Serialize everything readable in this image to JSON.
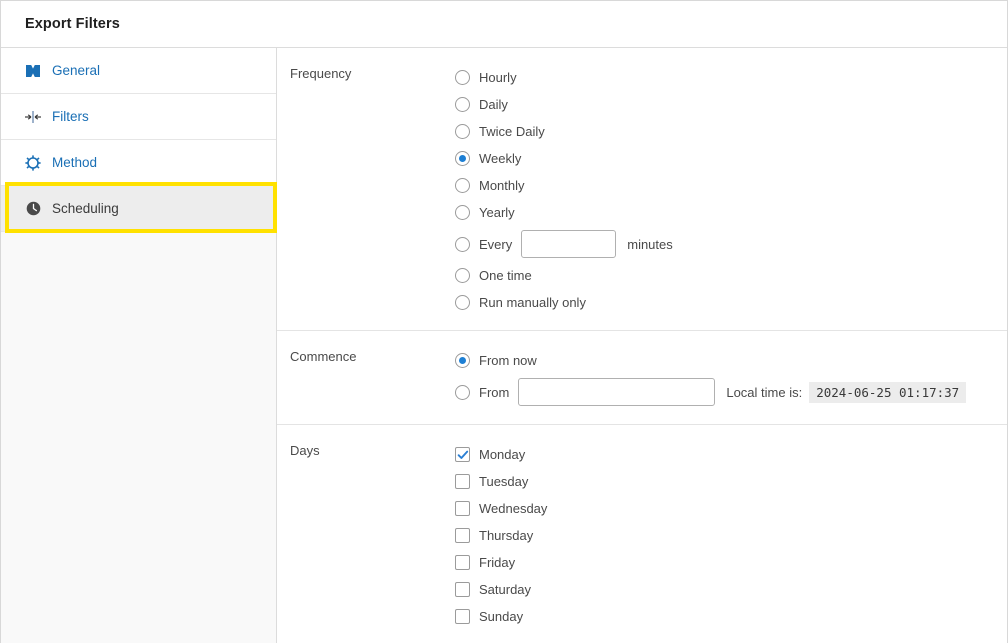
{
  "header": {
    "title": "Export Filters"
  },
  "sidebar": {
    "items": [
      {
        "label": "General",
        "icon": "ticket-icon",
        "selected": false
      },
      {
        "label": "Filters",
        "icon": "filter-arrows-icon",
        "selected": false
      },
      {
        "label": "Method",
        "icon": "gear-icon",
        "selected": false
      },
      {
        "label": "Scheduling",
        "icon": "clock-icon",
        "selected": true
      }
    ],
    "highlight_color": "#ffe100"
  },
  "main": {
    "sections": [
      {
        "label": "Frequency",
        "options": [
          {
            "label": "Hourly",
            "checked": false
          },
          {
            "label": "Daily",
            "checked": false
          },
          {
            "label": "Twice Daily",
            "checked": false
          },
          {
            "label": "Weekly",
            "checked": true
          },
          {
            "label": "Monthly",
            "checked": false
          },
          {
            "label": "Yearly",
            "checked": false
          },
          {
            "label": "Every",
            "checked": false
          },
          {
            "label": "One time",
            "checked": false
          },
          {
            "label": "Run manually only",
            "checked": false
          }
        ],
        "minutes_input_value": "",
        "minutes_unit_label": "minutes"
      },
      {
        "label": "Commence",
        "options": [
          {
            "label": "From now",
            "checked": true
          },
          {
            "label": "From",
            "checked": false
          }
        ],
        "from_input_value": "",
        "local_time_label": "Local time is:",
        "local_time_value": "2024-06-25 01:17:37"
      },
      {
        "label": "Days",
        "days": [
          {
            "label": "Monday",
            "checked": true
          },
          {
            "label": "Tuesday",
            "checked": false
          },
          {
            "label": "Wednesday",
            "checked": false
          },
          {
            "label": "Thursday",
            "checked": false
          },
          {
            "label": "Friday",
            "checked": false
          },
          {
            "label": "Saturday",
            "checked": false
          },
          {
            "label": "Sunday",
            "checked": false
          }
        ]
      }
    ]
  },
  "colors": {
    "link": "#1a6fb5",
    "accent": "#1d7fd4",
    "highlight": "#ffe100"
  }
}
